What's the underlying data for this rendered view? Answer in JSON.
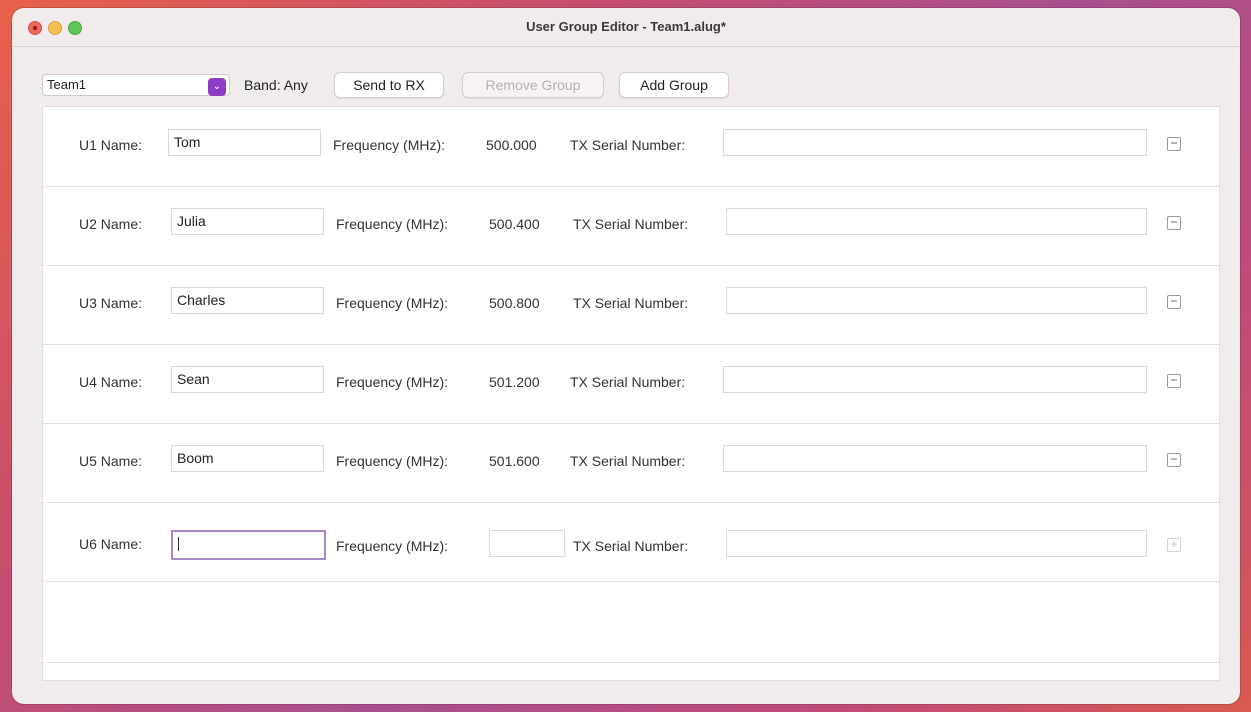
{
  "window": {
    "title": "User Group Editor - Team1.alug*"
  },
  "toolbar": {
    "group_select": "Team1",
    "band_label": "Band: Any",
    "send_label": "Send to RX",
    "remove_label": "Remove Group",
    "add_label": "Add Group"
  },
  "labels": {
    "frequency": "Frequency (MHz):",
    "tx_serial": "TX Serial Number:"
  },
  "users": [
    {
      "label": "U1 Name:",
      "name": "Tom",
      "frequency": "500.000",
      "serial": ""
    },
    {
      "label": "U2 Name:",
      "name": "Julia",
      "frequency": "500.400",
      "serial": ""
    },
    {
      "label": "U3 Name:",
      "name": "Charles",
      "frequency": "500.800",
      "serial": ""
    },
    {
      "label": "U4 Name:",
      "name": "Sean",
      "frequency": "501.200",
      "serial": ""
    },
    {
      "label": "U5 Name:",
      "name": "Boom",
      "frequency": "501.600",
      "serial": ""
    },
    {
      "label": "U6 Name:",
      "name": "",
      "frequency": "",
      "serial": ""
    }
  ],
  "icons": {
    "remove": "minus-icon",
    "add": "plus-icon",
    "dropdown": "chevron-down-icon"
  },
  "colors": {
    "accent": "#8e3cc6",
    "focus_ring": "#a887c9"
  }
}
